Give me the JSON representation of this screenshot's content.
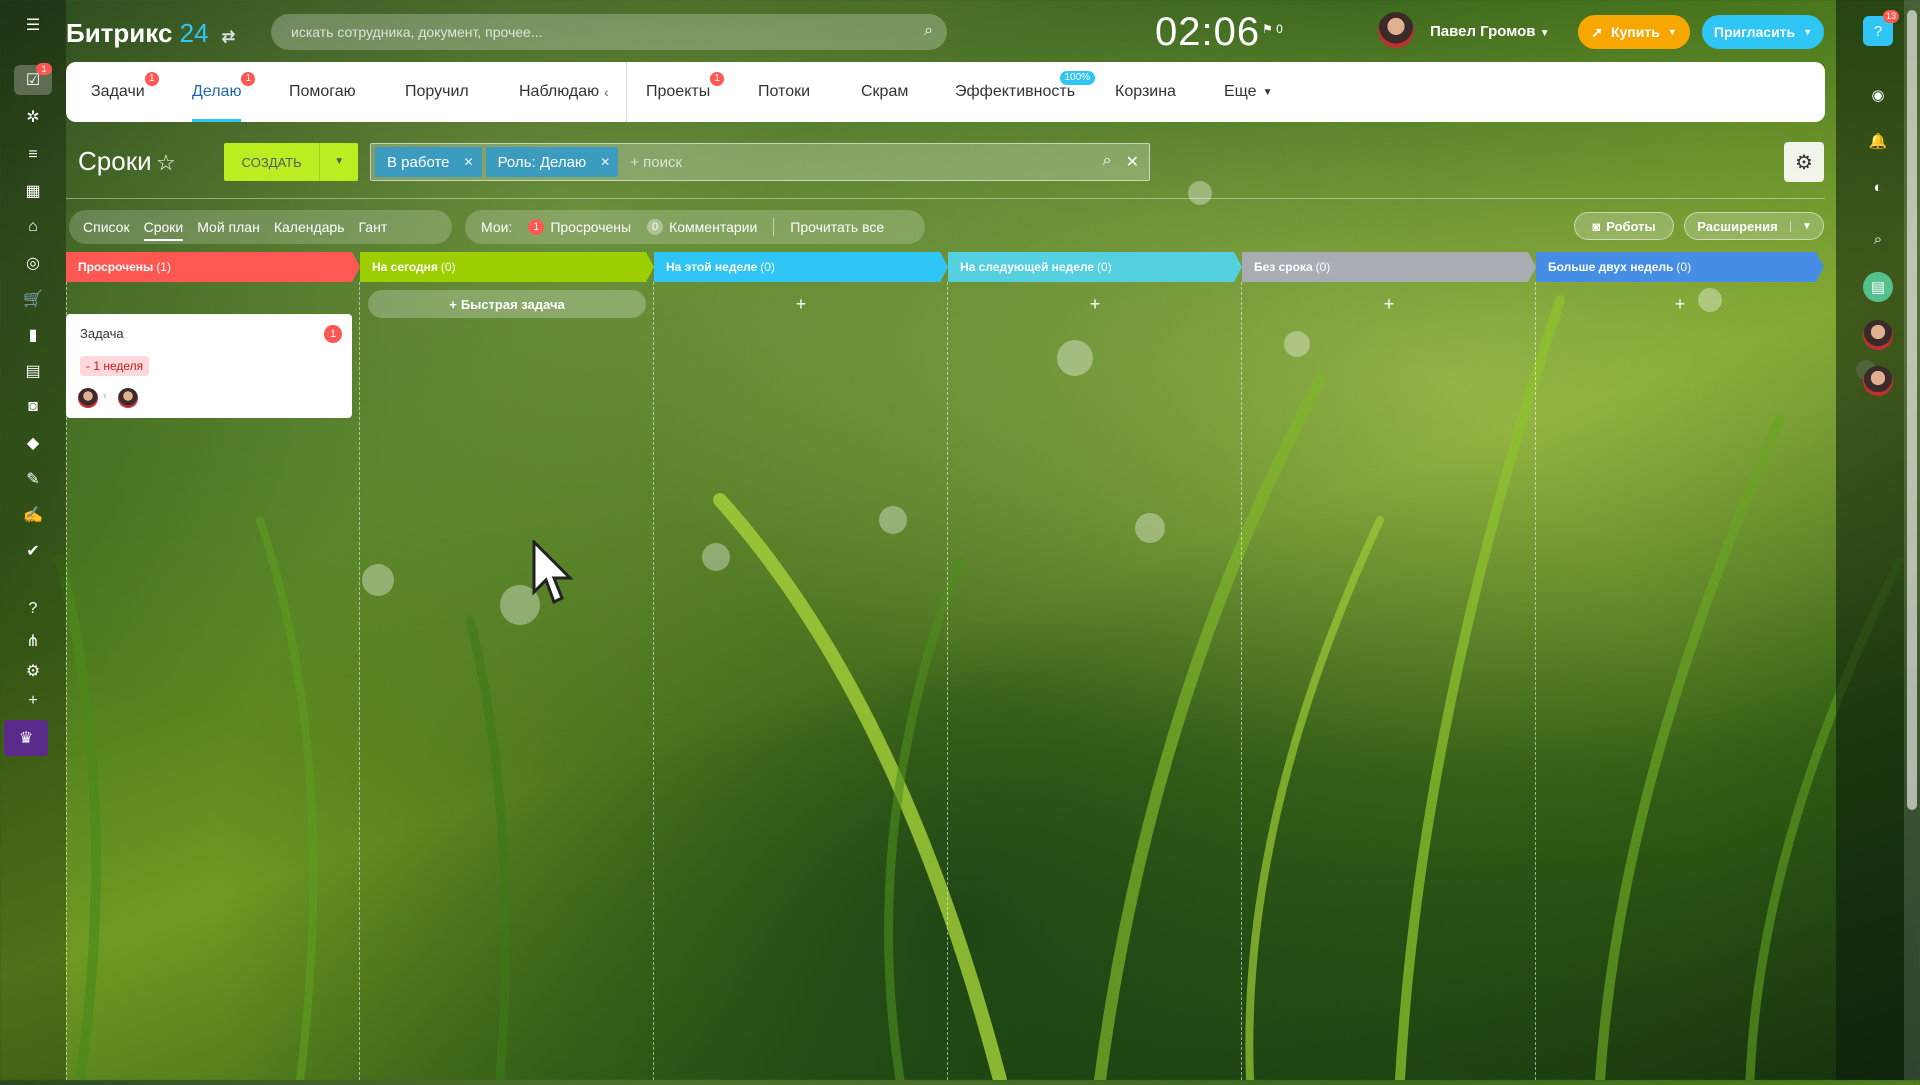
{
  "header": {
    "logo_text": "Битрикс",
    "logo_num": "24",
    "search_placeholder": "искать сотрудника, документ, прочее...",
    "clock": "02:06",
    "flag_count": "0",
    "user_name": "Павел Громов",
    "buy_label": "Купить",
    "invite_label": "Пригласить"
  },
  "left_sidebar": {
    "badge": "1",
    "icons": [
      "tasks-icon",
      "feed-icon",
      "filter-icon",
      "calendar-icon",
      "home-icon",
      "target-icon",
      "cart-icon",
      "chart-icon",
      "contact-card-icon",
      "robot-icon",
      "box-icon",
      "edit-list-icon",
      "sign-icon",
      "check-icon",
      "help-icon",
      "sitemap-icon",
      "settings-icon",
      "plus-icon",
      "crown-icon"
    ]
  },
  "right_sidebar": {
    "help_badge": "13"
  },
  "tabs": [
    {
      "label": "Задачи",
      "badge": "1"
    },
    {
      "label": "Делаю",
      "badge": "1",
      "active": true
    },
    {
      "label": "Помогаю"
    },
    {
      "label": "Поручил"
    },
    {
      "label": "Наблюдаю"
    },
    {
      "label": "Проекты",
      "badge": "1"
    },
    {
      "label": "Потоки"
    },
    {
      "label": "Скрам"
    },
    {
      "label": "Эффективность",
      "pct": "100%"
    },
    {
      "label": "Корзина"
    },
    {
      "label": "Еще"
    }
  ],
  "title": "Сроки",
  "create_label": "СОЗДАТЬ",
  "filter": {
    "chips": [
      "В работе",
      "Роль: Делаю"
    ],
    "placeholder": "+ поиск"
  },
  "views": [
    "Список",
    "Сроки",
    "Мой план",
    "Календарь",
    "Гант"
  ],
  "counters": {
    "label": "Мои:",
    "overdue_count": "1",
    "overdue_label": "Просрочены",
    "comments_count": "0",
    "comments_label": "Комментарии",
    "read_all": "Прочитать все"
  },
  "robots_label": "Роботы",
  "extensions_label": "Расширения",
  "columns": [
    {
      "title": "Просрочены",
      "count": "(1)",
      "color": "#ff5752"
    },
    {
      "title": "На сегодня",
      "count": "(0)",
      "color": "#9dcf00"
    },
    {
      "title": "На этой неделе",
      "count": "(0)",
      "color": "#2fc6f6"
    },
    {
      "title": "На следующей неделе",
      "count": "(0)",
      "color": "#55d0e0"
    },
    {
      "title": "Без срока",
      "count": "(0)",
      "color": "#a8adb4"
    },
    {
      "title": "Больше двух недель",
      "count": "(0)",
      "color": "#468ee5"
    }
  ],
  "quick_task_label": "Быстрая задача",
  "card": {
    "title": "Задача",
    "badge": "1",
    "deadline": "- 1 неделя"
  }
}
